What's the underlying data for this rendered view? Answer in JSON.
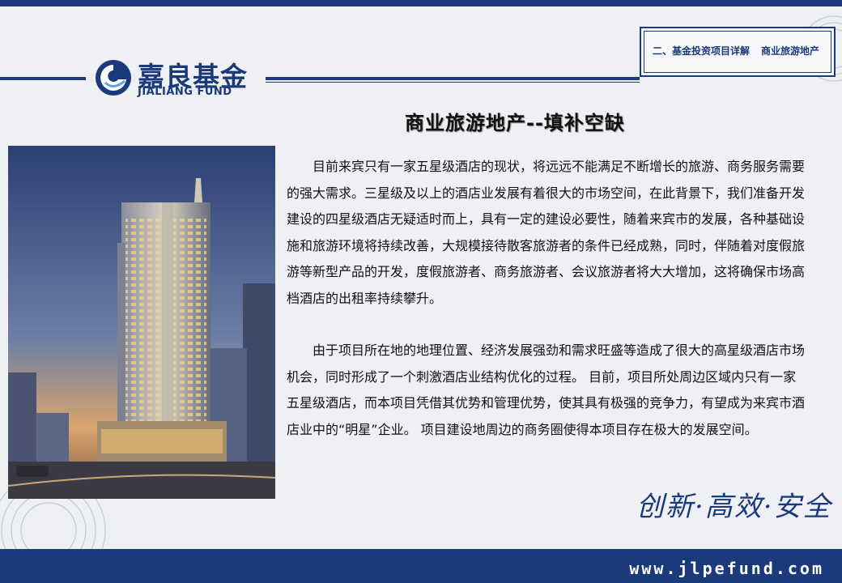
{
  "header": {
    "logo_cn": "嘉良基金",
    "logo_en": "JIALIANG FUND",
    "section_label": "二、基金投资项目详解",
    "section_sub": "商业旅游地产"
  },
  "title": "商业旅游地产--填补空缺",
  "paragraphs": [
    "目前来宾只有一家五星级酒店的现状，将远远不能满足不断增长的旅游、商务服务需要的强大需求。三星级及以上的酒店业发展有着很大的市场空间，在此背景下，我们准备开发建设的四星级酒店无疑适时而上，具有一定的建设必要性，随着来宾市的发展，各种基础设施和旅游环境将持续改善，大规模接待散客旅游者的条件已经成熟，同时，伴随着对度假旅游等新型产品的开发，度假旅游者、商务旅游者、会议旅游者将大大增加，这将确保市场高档酒店的出租率持续攀升。",
    "由于项目所在地的地理位置、经济发展强劲和需求旺盛等造成了很大的高星级酒店市场机会，同时形成了一个刺激酒店业结构优化的过程。 目前，项目所处周边区域内只有一家五星级酒店，而本项目凭借其优势和管理优势，使其具有极强的竞争力，有望成为来宾市酒店业中的“明星”企业。 项目建设地周边的商务圈使得本项目存在极大的发展空间。"
  ],
  "slogan": "创新·高效·安全",
  "footer": {
    "website": "www.jlpefund.com"
  },
  "colors": {
    "brand": "#1b3a7c",
    "background": "#eef0f4"
  },
  "image": {
    "subject": "hotel-tower-rendering"
  }
}
